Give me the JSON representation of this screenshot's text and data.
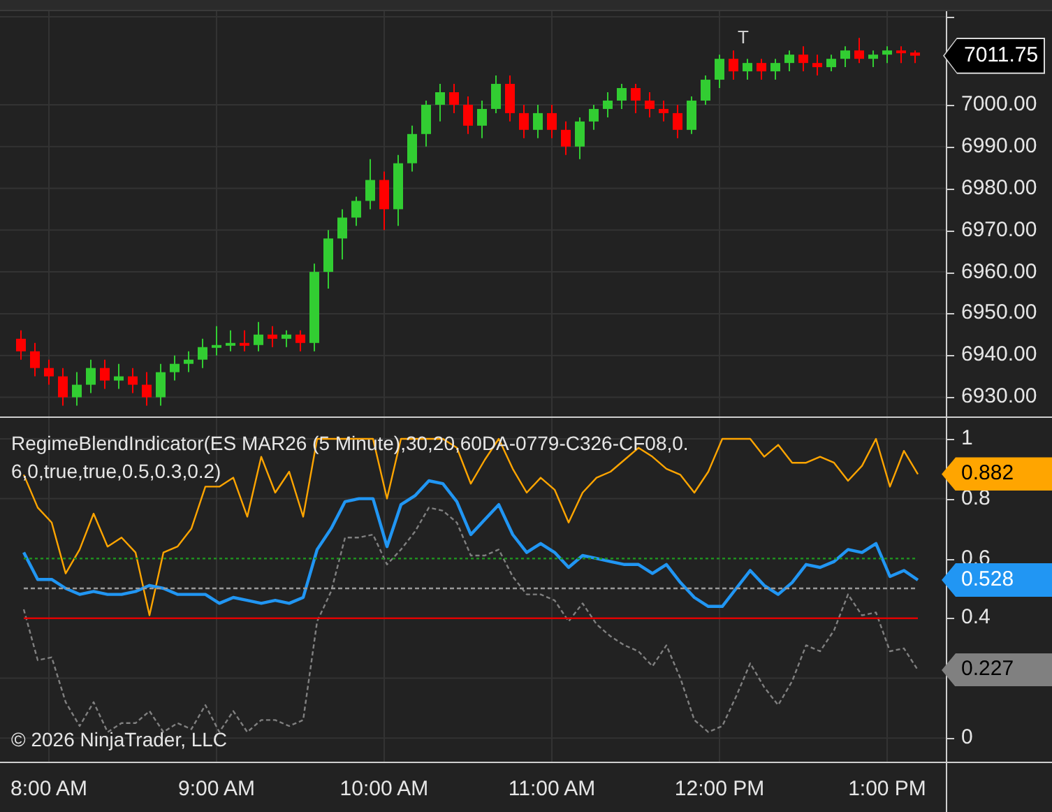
{
  "price_panel": {
    "marker": "T",
    "last_price": "7011.75",
    "chart_data": {
      "type": "candlestick",
      "grid": true,
      "ylim": [
        6925.4,
        7022.4
      ],
      "yticks": [
        {
          "value": 7000,
          "label": "7000.00"
        },
        {
          "value": 6990,
          "label": "6990.00"
        },
        {
          "value": 6980,
          "label": "6980.00"
        },
        {
          "value": 6970,
          "label": "6970.00"
        },
        {
          "value": 6960,
          "label": "6960.00"
        },
        {
          "value": 6950,
          "label": "6950.00"
        },
        {
          "value": 6940,
          "label": "6940.00"
        },
        {
          "value": 6930,
          "label": "6930.00"
        }
      ],
      "ohlc": [
        [
          6944,
          6946,
          6939,
          6941
        ],
        [
          6941,
          6943,
          6935,
          6937
        ],
        [
          6937,
          6939,
          6933,
          6935
        ],
        [
          6935,
          6937,
          6928,
          6930
        ],
        [
          6930,
          6936,
          6928,
          6933
        ],
        [
          6933,
          6939,
          6931,
          6937
        ],
        [
          6937,
          6939,
          6932,
          6934
        ],
        [
          6934,
          6938,
          6932,
          6935
        ],
        [
          6935,
          6937,
          6931,
          6933
        ],
        [
          6933,
          6936,
          6928,
          6930
        ],
        [
          6930,
          6938,
          6928,
          6936
        ],
        [
          6936,
          6940,
          6934,
          6938
        ],
        [
          6938,
          6941,
          6936,
          6939
        ],
        [
          6939,
          6944,
          6937,
          6942
        ],
        [
          6942,
          6947,
          6940,
          6942.5
        ],
        [
          6942.5,
          6946,
          6941,
          6943
        ],
        [
          6943,
          6946,
          6941,
          6942.5
        ],
        [
          6942.5,
          6948,
          6941,
          6945
        ],
        [
          6945,
          6947,
          6942,
          6944
        ],
        [
          6944,
          6946,
          6942,
          6945
        ],
        [
          6945,
          6946,
          6941,
          6943
        ],
        [
          6943,
          6962,
          6941,
          6960
        ],
        [
          6960,
          6970,
          6956,
          6968
        ],
        [
          6968,
          6975,
          6963,
          6973
        ],
        [
          6973,
          6978,
          6971,
          6977
        ],
        [
          6977,
          6987,
          6975,
          6982
        ],
        [
          6982,
          6984,
          6970,
          6975
        ],
        [
          6975,
          6988,
          6971,
          6986
        ],
        [
          6986,
          6995,
          6984,
          6993
        ],
        [
          6993,
          7001,
          6990,
          7000
        ],
        [
          7000,
          7005,
          6996,
          7003
        ],
        [
          7003,
          7005,
          6998,
          7000
        ],
        [
          7000,
          7002,
          6993,
          6995
        ],
        [
          6995,
          7001,
          6992,
          6999
        ],
        [
          6999,
          7007,
          6998,
          7005
        ],
        [
          7005,
          7007,
          6996,
          6998
        ],
        [
          6998,
          7000,
          6992,
          6994
        ],
        [
          6994,
          7000,
          6992,
          6998
        ],
        [
          6998,
          7000,
          6992,
          6994
        ],
        [
          6994,
          6996,
          6988,
          6990
        ],
        [
          6990,
          6997,
          6987,
          6996
        ],
        [
          6996,
          7000,
          6994,
          6999
        ],
        [
          6999,
          7003,
          6997,
          7001
        ],
        [
          7001,
          7005,
          6999,
          7004
        ],
        [
          7004,
          7005,
          6998,
          7001
        ],
        [
          7001,
          7003,
          6997,
          6999
        ],
        [
          6999,
          7001,
          6996,
          6998
        ],
        [
          6998,
          7000,
          6992,
          6994
        ],
        [
          6994,
          7002,
          6993,
          7001
        ],
        [
          7001,
          7007,
          7000,
          7006
        ],
        [
          7006,
          7012,
          7004,
          7011
        ],
        [
          7011,
          7013,
          7006,
          7008
        ],
        [
          7008,
          7011,
          7006,
          7010
        ],
        [
          7010,
          7011,
          7006,
          7008
        ],
        [
          7008,
          7011,
          7006,
          7010
        ],
        [
          7010,
          7013,
          7008,
          7012
        ],
        [
          7012,
          7014,
          7008,
          7010
        ],
        [
          7010,
          7012,
          7007,
          7009
        ],
        [
          7009,
          7012,
          7008,
          7011
        ],
        [
          7011,
          7014,
          7009,
          7013
        ],
        [
          7013,
          7016,
          7010,
          7011
        ],
        [
          7011,
          7013,
          7009,
          7012
        ],
        [
          7012,
          7014,
          7010,
          7013
        ],
        [
          7013,
          7014,
          7010,
          7012.5
        ],
        [
          7012.5,
          7013,
          7010,
          7011.75
        ]
      ]
    }
  },
  "indicator_panel": {
    "title": "RegimeBlendIndicator(ES MAR26 (5 Minute),30,20,60DA-0779-C326-CF08,0.6,0,true,true,0.5,0.3,0.2)",
    "copyright": "© 2026 NinjaTrader, LLC",
    "readouts": [
      {
        "text": "0.882",
        "color": "#ffa500"
      },
      {
        "text": "0.528",
        "color": "#2196f3"
      },
      {
        "text": "0.227",
        "color": "#808080"
      }
    ],
    "chart_data": {
      "type": "line",
      "grid": true,
      "ylim": [
        -0.079,
        1.07
      ],
      "yticks": [
        {
          "value": 1,
          "label": "1"
        },
        {
          "value": 0.8,
          "label": "0.8"
        },
        {
          "value": 0.6,
          "label": "0.6"
        },
        {
          "value": 0.4,
          "label": "0.4"
        },
        {
          "value": 0,
          "label": "0"
        }
      ],
      "series": [
        {
          "color": "#ffa500",
          "line_style": "solid",
          "values": [
            0.88,
            0.77,
            0.72,
            0.55,
            0.63,
            0.75,
            0.64,
            0.67,
            0.62,
            0.41,
            0.62,
            0.64,
            0.7,
            0.84,
            0.84,
            0.87,
            0.74,
            0.94,
            0.82,
            0.89,
            0.74,
            1,
            1,
            1,
            1,
            1,
            0.8,
            1,
            1,
            1,
            1,
            0.97,
            0.85,
            0.93,
            1,
            0.9,
            0.82,
            0.87,
            0.83,
            0.72,
            0.82,
            0.87,
            0.89,
            0.93,
            0.97,
            0.94,
            0.9,
            0.88,
            0.82,
            0.89,
            1,
            1,
            1,
            0.94,
            0.98,
            0.92,
            0.92,
            0.94,
            0.92,
            0.86,
            0.91,
            1,
            0.84,
            0.96,
            0.882
          ]
        },
        {
          "color": "#2196f3",
          "line_style": "solid",
          "values": [
            0.62,
            0.53,
            0.53,
            0.5,
            0.48,
            0.49,
            0.48,
            0.48,
            0.49,
            0.51,
            0.5,
            0.48,
            0.48,
            0.48,
            0.45,
            0.47,
            0.46,
            0.45,
            0.46,
            0.45,
            0.47,
            0.63,
            0.7,
            0.79,
            0.8,
            0.8,
            0.64,
            0.78,
            0.81,
            0.86,
            0.85,
            0.79,
            0.68,
            0.73,
            0.78,
            0.68,
            0.62,
            0.65,
            0.62,
            0.57,
            0.61,
            0.6,
            0.59,
            0.58,
            0.58,
            0.55,
            0.58,
            0.52,
            0.47,
            0.44,
            0.44,
            0.5,
            0.56,
            0.51,
            0.48,
            0.52,
            0.58,
            0.57,
            0.59,
            0.63,
            0.62,
            0.65,
            0.54,
            0.56,
            0.528
          ]
        },
        {
          "color": "#808080",
          "line_style": "dashed",
          "values": [
            0.43,
            0.26,
            0.27,
            0.12,
            0.04,
            0.12,
            0.02,
            0.05,
            0.05,
            0.09,
            0.02,
            0.05,
            0.03,
            0.11,
            0.02,
            0.09,
            0.02,
            0.06,
            0.06,
            0.04,
            0.06,
            0.39,
            0.49,
            0.67,
            0.67,
            0.68,
            0.58,
            0.63,
            0.69,
            0.77,
            0.76,
            0.72,
            0.61,
            0.61,
            0.63,
            0.54,
            0.48,
            0.48,
            0.46,
            0.39,
            0.45,
            0.38,
            0.34,
            0.31,
            0.29,
            0.24,
            0.31,
            0.2,
            0.06,
            0.02,
            0.04,
            0.14,
            0.25,
            0.17,
            0.11,
            0.19,
            0.31,
            0.29,
            0.36,
            0.48,
            0.41,
            0.42,
            0.29,
            0.3,
            0.227
          ]
        },
        {
          "color": "#1f8f1f",
          "line_style": "dotted",
          "values": [
            0.6,
            0.6,
            0.6,
            0.6,
            0.6,
            0.6,
            0.6,
            0.6,
            0.6,
            0.6,
            0.6,
            0.6,
            0.6,
            0.6,
            0.6,
            0.6,
            0.6,
            0.6,
            0.6,
            0.6,
            0.6,
            0.6,
            0.6,
            0.6,
            0.6,
            0.6,
            0.6,
            0.6,
            0.6,
            0.6,
            0.6,
            0.6,
            0.6,
            0.6,
            0.6,
            0.6,
            0.6,
            0.6,
            0.6,
            0.6,
            0.6,
            0.6,
            0.6,
            0.6,
            0.6,
            0.6,
            0.6,
            0.6,
            0.6,
            0.6,
            0.6,
            0.6,
            0.6,
            0.6,
            0.6,
            0.6,
            0.6,
            0.6,
            0.6,
            0.6,
            0.6,
            0.6,
            0.6,
            0.6,
            0.6
          ]
        },
        {
          "color": "#9a9a9a",
          "line_style": "dashed",
          "values": [
            0.5,
            0.5,
            0.5,
            0.5,
            0.5,
            0.5,
            0.5,
            0.5,
            0.5,
            0.5,
            0.5,
            0.5,
            0.5,
            0.5,
            0.5,
            0.5,
            0.5,
            0.5,
            0.5,
            0.5,
            0.5,
            0.5,
            0.5,
            0.5,
            0.5,
            0.5,
            0.5,
            0.5,
            0.5,
            0.5,
            0.5,
            0.5,
            0.5,
            0.5,
            0.5,
            0.5,
            0.5,
            0.5,
            0.5,
            0.5,
            0.5,
            0.5,
            0.5,
            0.5,
            0.5,
            0.5,
            0.5,
            0.5,
            0.5,
            0.5,
            0.5,
            0.5,
            0.5,
            0.5,
            0.5,
            0.5,
            0.5,
            0.5,
            0.5,
            0.5,
            0.5,
            0.5,
            0.5,
            0.5,
            0.5
          ]
        },
        {
          "color": "#e00000",
          "line_style": "solid",
          "values": [
            0.4,
            0.4,
            0.4,
            0.4,
            0.4,
            0.4,
            0.4,
            0.4,
            0.4,
            0.4,
            0.4,
            0.4,
            0.4,
            0.4,
            0.4,
            0.4,
            0.4,
            0.4,
            0.4,
            0.4,
            0.4,
            0.4,
            0.4,
            0.4,
            0.4,
            0.4,
            0.4,
            0.4,
            0.4,
            0.4,
            0.4,
            0.4,
            0.4,
            0.4,
            0.4,
            0.4,
            0.4,
            0.4,
            0.4,
            0.4,
            0.4,
            0.4,
            0.4,
            0.4,
            0.4,
            0.4,
            0.4,
            0.4,
            0.4,
            0.4,
            0.4,
            0.4,
            0.4,
            0.4,
            0.4,
            0.4,
            0.4,
            0.4,
            0.4,
            0.4,
            0.4,
            0.4,
            0.4,
            0.4,
            0.4
          ]
        }
      ]
    }
  },
  "time_axis": [
    "8:00 AM",
    "9:00 AM",
    "10:00 AM",
    "11:00 AM",
    "12:00 PM",
    "1:00 PM"
  ]
}
